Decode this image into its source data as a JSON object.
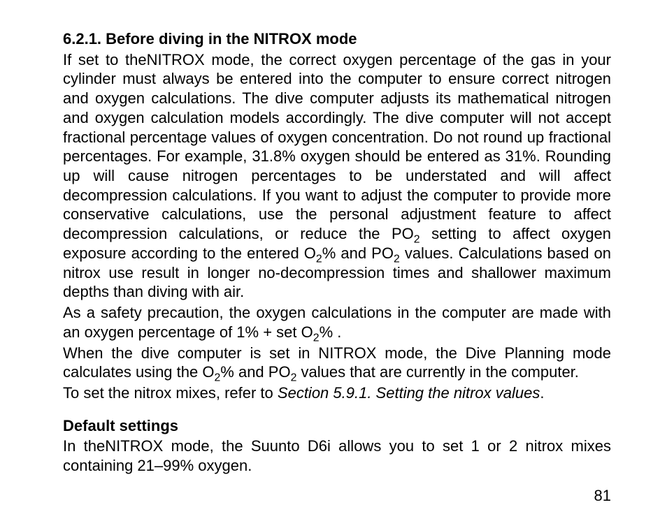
{
  "section": {
    "heading": "6.2.1. Before diving in the NITROX mode",
    "para1_a": "If set to theNITROX mode, the correct oxygen percentage of the gas in your cylinder must always be entered into the computer to ensure correct nitrogen and oxygen calculations. The dive computer adjusts its mathematical nitrogen and oxygen calculation models accordingly. The dive computer will not accept fractional percentage values of oxygen concentration. Do not round up fractional percentages. For example, 31.8% oxygen should be entered as 31%. Rounding up will cause nitrogen percentages to be understated and will affect decompression calculations. If you want to adjust the computer to provide more conservative calculations, use the personal adjustment feature to affect decompression calculations, or reduce the PO",
    "para1_b": " setting to affect oxygen exposure according to the entered O",
    "para1_c": "% and PO",
    "para1_d": " values. Calculations based on nitrox use result in longer no-decompression times and shallower maximum depths than diving with air.",
    "para2_a": "As a safety precaution, the oxygen calculations in the computer are made with an oxygen percentage of 1% + set O",
    "para2_b": "% .",
    "para3_a": "When the dive computer is set in NITROX mode, the Dive Planning mode calculates using the O",
    "para3_b": "% and PO",
    "para3_c": " values that are currently in the computer.",
    "para4_a": "To set the nitrox mixes, refer to ",
    "para4_ref": "Section 5.9.1. Setting the nitrox values",
    "para4_b": ".",
    "sub2": "2",
    "defaults_heading": "Default settings",
    "defaults_para": "In theNITROX mode, the Suunto D6i allows you to set 1 or 2 nitrox mixes containing 21–99% oxygen."
  },
  "page_number": "81"
}
